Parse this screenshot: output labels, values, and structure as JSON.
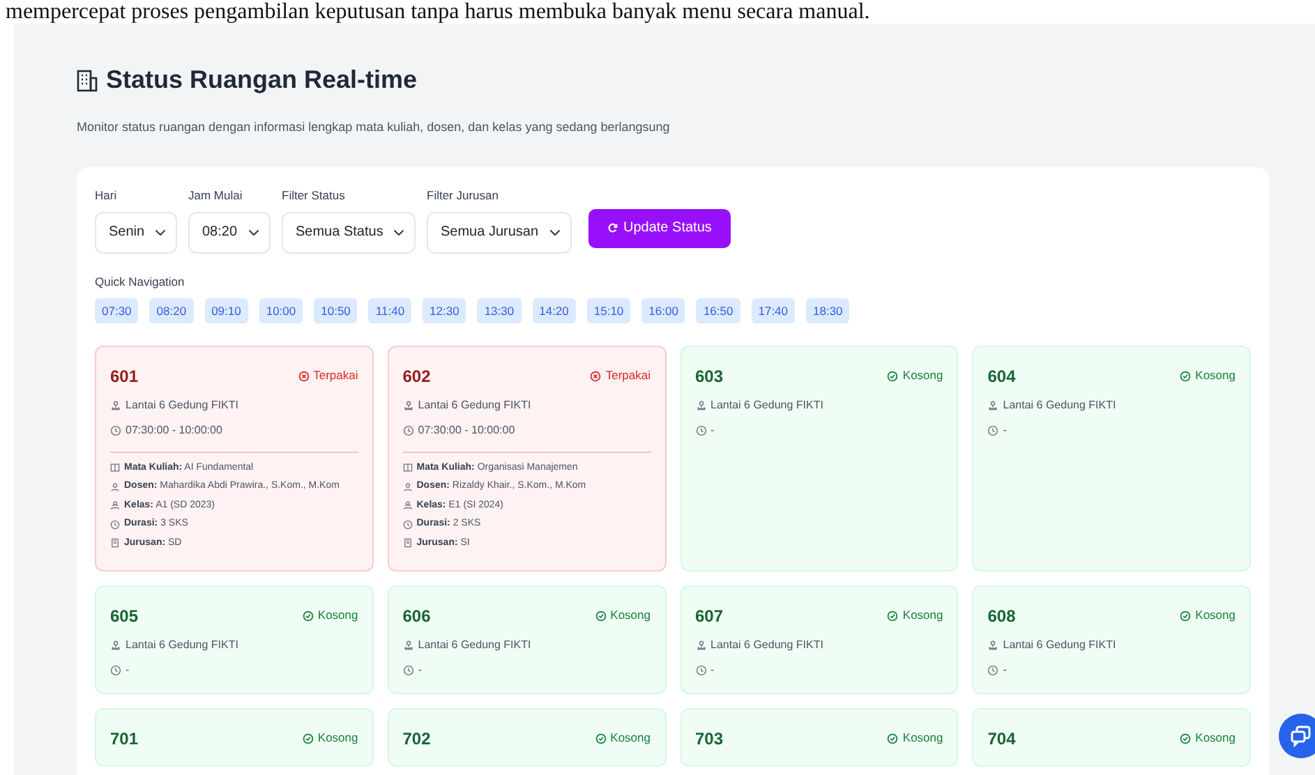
{
  "caption_text": "mempercepat proses pengambilan keputusan tanpa harus membuka banyak menu secara manual.",
  "header": {
    "title": "Status Ruangan Real-time",
    "subtitle": "Monitor status ruangan dengan informasi lengkap mata kuliah, dosen, dan kelas yang sedang berlangsung"
  },
  "filters": [
    {
      "label": "Hari",
      "value": "Senin"
    },
    {
      "label": "Jam Mulai",
      "value": "08:20"
    },
    {
      "label": "Filter Status",
      "value": "Semua Status"
    },
    {
      "label": "Filter Jurusan",
      "value": "Semua Jurusan"
    }
  ],
  "update_button": "Update Status",
  "quick_navigation": {
    "label": "Quick Navigation",
    "times": [
      "07:30",
      "08:20",
      "09:10",
      "10:00",
      "10:50",
      "11:40",
      "12:30",
      "13:30",
      "14:20",
      "15:10",
      "16:00",
      "16:50",
      "17:40",
      "18:30"
    ]
  },
  "rooms": [
    {
      "number": "601",
      "kind": "used",
      "status": "Terpakai",
      "location": "Lantai 6 Gedung FIKTI",
      "time": "07:30:00 - 10:00:00",
      "details": [
        {
          "kind": "course",
          "text": "**Mata Kuliah:** AI Fundamental"
        },
        {
          "kind": "lecturer",
          "text": "**Dosen:** Mahardika Abdi Prawira., S.Kom., M.Kom"
        },
        {
          "kind": "class",
          "text": "**Kelas:** A1 (SD 2023)"
        },
        {
          "kind": "duration",
          "text": "**Durasi:** 3 SKS"
        },
        {
          "kind": "major",
          "text": "**Jurusan:** SD"
        }
      ]
    },
    {
      "number": "602",
      "kind": "used",
      "status": "Terpakai",
      "location": "Lantai 6 Gedung FIKTI",
      "time": "07:30:00 - 10:00:00",
      "details": [
        {
          "kind": "course",
          "text": "**Mata Kuliah:** Organisasi Manajemen"
        },
        {
          "kind": "lecturer",
          "text": "**Dosen:** Rizaldy Khair., S.Kom., M.Kom"
        },
        {
          "kind": "class",
          "text": "**Kelas:** E1 (SI 2024)"
        },
        {
          "kind": "duration",
          "text": "**Durasi:** 2 SKS"
        },
        {
          "kind": "major",
          "text": "**Jurusan:** SI"
        }
      ]
    },
    {
      "number": "603",
      "kind": "empty",
      "status": "Kosong",
      "location": "Lantai 6 Gedung FIKTI",
      "time": "-"
    },
    {
      "number": "604",
      "kind": "empty",
      "status": "Kosong",
      "location": "Lantai 6 Gedung FIKTI",
      "time": "-"
    },
    {
      "number": "605",
      "kind": "empty",
      "status": "Kosong",
      "location": "Lantai 6 Gedung FIKTI",
      "time": "-"
    },
    {
      "number": "606",
      "kind": "empty",
      "status": "Kosong",
      "location": "Lantai 6 Gedung FIKTI",
      "time": "-"
    },
    {
      "number": "607",
      "kind": "empty",
      "status": "Kosong",
      "location": "Lantai 6 Gedung FIKTI",
      "time": "-"
    },
    {
      "number": "608",
      "kind": "empty",
      "status": "Kosong",
      "location": "Lantai 6 Gedung FIKTI",
      "time": "-"
    },
    {
      "number": "701",
      "kind": "empty",
      "status": "Kosong"
    },
    {
      "number": "702",
      "kind": "empty",
      "status": "Kosong"
    },
    {
      "number": "703",
      "kind": "empty",
      "status": "Kosong"
    },
    {
      "number": "704",
      "kind": "empty",
      "status": "Kosong"
    }
  ]
}
